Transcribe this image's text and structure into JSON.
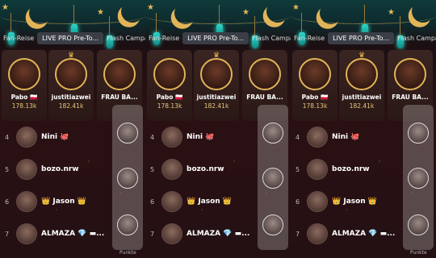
{
  "tabs": [
    "Fan-Reise",
    "LIVE PRO Pre-To...",
    "Flash Campa"
  ],
  "top": [
    {
      "name": "Pabo",
      "flag": "🇵🇱",
      "score": "178.13k"
    },
    {
      "name": "justitiazwei",
      "score": "182.41k"
    },
    {
      "name": "FRAU BA..."
    }
  ],
  "rows": [
    {
      "rank": "4",
      "name": "Nini 🐙"
    },
    {
      "rank": "5",
      "name": "bozo.nrw"
    },
    {
      "rank": "6",
      "name": "👑 Jason 👑"
    },
    {
      "rank": "7",
      "name": "ALMAZA 💎 ▬..."
    }
  ],
  "footer": {
    "punkte": "Punkte"
  },
  "icons": {
    "moon": "crescent-moon-icon",
    "lamp": "lantern-icon",
    "star": "star-icon",
    "crown": "crown-icon"
  },
  "colors": {
    "gold": "#e2b458",
    "teal": "#2fd6c8",
    "bg": "#1b0b0c"
  }
}
